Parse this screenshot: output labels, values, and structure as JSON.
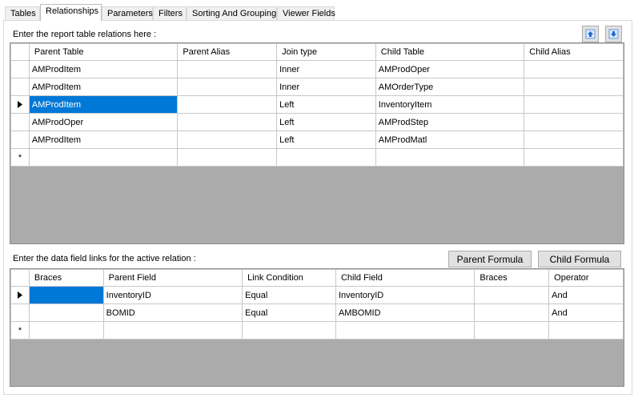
{
  "tabs": [
    {
      "label": "Tables"
    },
    {
      "label": "Relationships"
    },
    {
      "label": "Parameters"
    },
    {
      "label": "Filters"
    },
    {
      "label": "Sorting And Grouping"
    },
    {
      "label": "Viewer Fields"
    }
  ],
  "active_tab": "Relationships",
  "relations": {
    "label": "Enter the report table relations here :",
    "move_up_icon": "arrow-up-icon",
    "move_down_icon": "arrow-down-icon",
    "columns": [
      "Parent Table",
      "Parent Alias",
      "Join type",
      "Child Table",
      "Child Alias"
    ],
    "rows": [
      {
        "parent_table": "AMProdItem",
        "parent_alias": "",
        "join_type": "Inner",
        "child_table": "AMProdOper",
        "child_alias": ""
      },
      {
        "parent_table": "AMProdItem",
        "parent_alias": "",
        "join_type": "Inner",
        "child_table": "AMOrderType",
        "child_alias": ""
      },
      {
        "parent_table": "AMProdItem",
        "parent_alias": "",
        "join_type": "Left",
        "child_table": "InventoryItem",
        "child_alias": ""
      },
      {
        "parent_table": "AMProdOper",
        "parent_alias": "",
        "join_type": "Left",
        "child_table": "AMProdStep",
        "child_alias": ""
      },
      {
        "parent_table": "AMProdItem",
        "parent_alias": "",
        "join_type": "Left",
        "child_table": "AMProdMatl",
        "child_alias": ""
      }
    ],
    "current_row_marker": "▶",
    "new_row_marker": "*"
  },
  "links": {
    "label": "Enter the data field links for the active relation :",
    "parent_formula_label": "Parent Formula",
    "child_formula_label": "Child Formula",
    "columns": [
      "Braces",
      "Parent Field",
      "Link Condition",
      "Child Field",
      "Braces",
      "Operator"
    ],
    "rows": [
      {
        "open_braces": "",
        "parent_field": "InventoryID",
        "link_condition": "Equal",
        "child_field": "InventoryID",
        "close_braces": "",
        "operator": "And"
      },
      {
        "open_braces": "",
        "parent_field": "BOMID",
        "link_condition": "Equal",
        "child_field": "AMBOMID",
        "close_braces": "",
        "operator": "And"
      }
    ],
    "current_row_marker": "▶",
    "new_row_marker": "*"
  },
  "colors": {
    "selection": "#0078d7",
    "grid_background": "#ababab",
    "arrow_icon": "#1a66c9"
  }
}
